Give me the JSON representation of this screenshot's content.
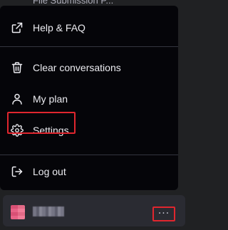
{
  "background_chat": {
    "label": "File Submission P..."
  },
  "menu": {
    "items": [
      {
        "label": "Help & FAQ",
        "icon": "external-link-icon"
      },
      {
        "label": "Clear conversations",
        "icon": "trash-icon"
      },
      {
        "label": "My plan",
        "icon": "user-icon"
      },
      {
        "label": "Settings",
        "icon": "gear-icon"
      },
      {
        "label": "Log out",
        "icon": "logout-icon"
      }
    ]
  },
  "user": {
    "name": "",
    "more_label": "···"
  },
  "colors": {
    "menu_bg": "#050509",
    "sidebar_bg": "#202123",
    "user_bar_bg": "#2a2b32",
    "text": "#ececf1",
    "highlight": "#e0262e"
  }
}
